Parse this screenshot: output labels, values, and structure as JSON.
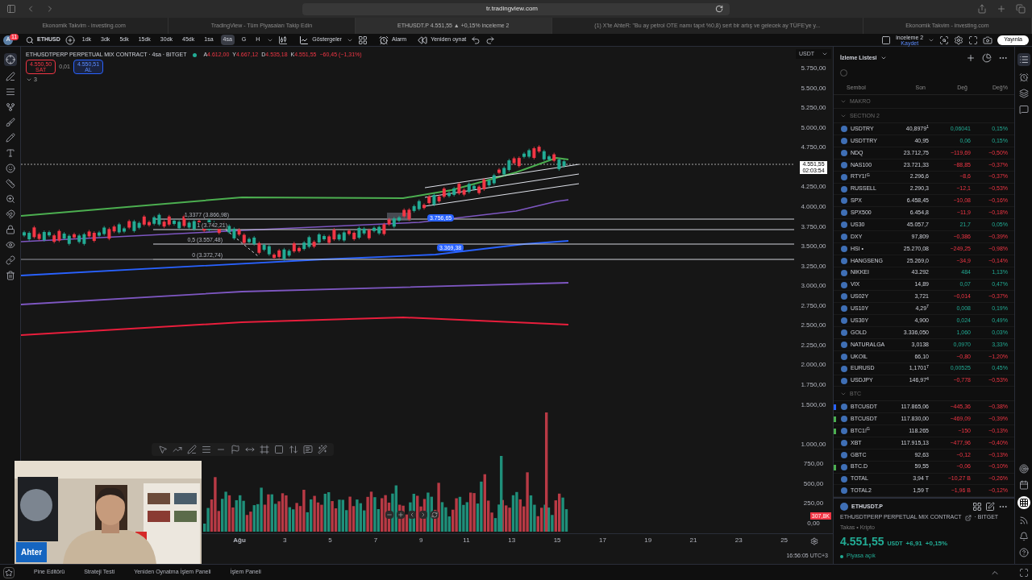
{
  "browser": {
    "address": "tr.tradingview.com",
    "tabs": [
      {
        "title": "Ekonomik Takvim - investing.com",
        "selected": false
      },
      {
        "title": "TradingView - Tüm Piyasaları Takip Edin",
        "selected": false
      },
      {
        "title": "ETHUSDT.P 4.551,55 ▲ +0,15% inceleme 2",
        "selected": true
      },
      {
        "title": "(1) X'te AhteR: \"Bu ay petrol OTE namı tapıt %0,8) sert bir artış ve gelecek ay TÜFE'ye y...",
        "selected": false
      },
      {
        "title": "Ekonomik Takvim - investing.com",
        "selected": false
      }
    ]
  },
  "toolbar": {
    "avatar": "A",
    "notifications": "11",
    "symbol": "ETHUSD",
    "intervals": [
      {
        "label": "1dk",
        "selected": false
      },
      {
        "label": "3dk",
        "selected": false
      },
      {
        "label": "5dk",
        "selected": false
      },
      {
        "label": "15dk",
        "selected": false
      },
      {
        "label": "30dk",
        "selected": false
      },
      {
        "label": "45dk",
        "selected": false
      },
      {
        "label": "1sa",
        "selected": false
      },
      {
        "label": "4sa",
        "selected": true
      },
      {
        "label": "G",
        "selected": false
      },
      {
        "label": "H",
        "selected": false
      }
    ],
    "indicators": "Göstergeler",
    "alert": "Alarm",
    "replay": "Yeniden oynat",
    "layout_name": "inceleme 2",
    "layout_status": "Kaydet",
    "publish": "Yayınla"
  },
  "chart": {
    "title": "ETHUSDTPERP PERPETUAL MIX CONTRACT · 4sa · BITGET",
    "ohlc": [
      {
        "label": "A",
        "value": "4.612,00"
      },
      {
        "label": "Y",
        "value": "4.667,12"
      },
      {
        "label": "D",
        "value": "4.535,18"
      },
      {
        "label": "K",
        "value": "4.551,55"
      }
    ],
    "change": "−60,45 (−1,31%)",
    "sell_price": "4.550,50",
    "sell_label": "SAT",
    "spread": "0,01",
    "buy_price": "4.550,51",
    "buy_label": "AL",
    "indicator_count": "3",
    "currency": "USDT",
    "price_axis": [
      "5.750,00",
      "5.500,00",
      "5.250,00",
      "5.000,00",
      "4.750,00",
      "4.250,00",
      "4.000,00",
      "3.750,00",
      "3.500,00",
      "3.250,00",
      "3.000,00",
      "2.750,00",
      "2.500,00",
      "2.250,00",
      "2.000,00",
      "1.750,00",
      "1.500,00"
    ],
    "last_price": "4.551,55",
    "countdown": "02:03:54",
    "volume_axis": [
      "1.000,00",
      "750,00",
      "500,00",
      "250,00",
      "0,00"
    ],
    "volume_label": "307,8K",
    "fib_levels": [
      "1,3377 (3.866,98)",
      "1 (3.742,21)",
      "0,5 (3.557,48)",
      "0 (3.372,74)"
    ],
    "line_labels": [
      "3.756,65",
      "3.369,38"
    ],
    "time_axis": [
      "Ağu",
      "3",
      "5",
      "7",
      "9",
      "11",
      "13",
      "15",
      "17",
      "19",
      "21",
      "23",
      "25"
    ],
    "clock": "16:56:05 UTC+3"
  },
  "webcam": {
    "kind": "picture",
    "name": "Ahter"
  },
  "watchlist": {
    "title": "İzleme Listesi",
    "columns": [
      "Sembol",
      "Son",
      "Değ",
      "Değ%"
    ],
    "sections": [
      {
        "name": "MAKRO"
      },
      {
        "name": "SECTION 2",
        "rows": [
          {
            "symbol": "USDTRY",
            "last": "40,8979$^{1}$",
            "change": "0,06041",
            "pct": "0,15%",
            "down": false
          },
          {
            "symbol": "USDTTRY",
            "last": "40,95",
            "change": "0,06",
            "pct": "0,15%",
            "down": false
          },
          {
            "symbol": "NDQ",
            "last": "23.712,75",
            "change": "−119,69",
            "pct": "−0,50%",
            "down": true
          },
          {
            "symbol": "NAS100",
            "last": "23.721,33",
            "change": "−88,85",
            "pct": "−0,37%",
            "down": true
          },
          {
            "symbol": "RTY1!$^{G}$",
            "last": "2.296,6",
            "change": "−8,6",
            "pct": "−0,37%",
            "down": true
          },
          {
            "symbol": "RUSSELL",
            "last": "2.290,3",
            "change": "−12,1",
            "pct": "−0,53%",
            "down": true
          },
          {
            "symbol": "SPX",
            "last": "6.458,45",
            "change": "−10,08",
            "pct": "−0,16%",
            "down": true
          },
          {
            "symbol": "SPX500",
            "last": "6.454,8",
            "change": "−11,9",
            "pct": "−0,18%",
            "down": true
          },
          {
            "symbol": "US30",
            "last": "45.057,7",
            "change": "21,7",
            "pct": "0,05%",
            "down": false
          },
          {
            "symbol": "DXY",
            "last": "97,809",
            "change": "−0,386",
            "pct": "−0,39%",
            "down": true
          },
          {
            "symbol": "HSI •",
            "last": "25.270,08",
            "change": "−249,25",
            "pct": "−0,98%",
            "down": true
          },
          {
            "symbol": "HANGSENG",
            "last": "25.269,0",
            "change": "−34,9",
            "pct": "−0,14%",
            "down": true
          },
          {
            "symbol": "NIKKEI",
            "last": "43.292",
            "change": "484",
            "pct": "1,13%",
            "down": false
          },
          {
            "symbol": "VIX",
            "last": "14,89",
            "change": "0,07",
            "pct": "0,47%",
            "down": false
          },
          {
            "symbol": "US02Y",
            "last": "3,721",
            "change": "−0,014",
            "pct": "−0,37%",
            "down": true
          },
          {
            "symbol": "US10Y",
            "last": "4,29$^{7}$",
            "change": "0,008",
            "pct": "0,19%",
            "down": false
          },
          {
            "symbol": "US30Y",
            "last": "4,900",
            "change": "0,024",
            "pct": "0,49%",
            "down": false
          },
          {
            "symbol": "GOLD",
            "last": "3.336,050",
            "change": "1,060",
            "pct": "0,03%",
            "down": false
          },
          {
            "symbol": "NATURALGA",
            "last": "3,0138",
            "change": "0,0970",
            "pct": "3,33%",
            "down": false
          },
          {
            "symbol": "UKOIL",
            "last": "66,10",
            "change": "−0,80",
            "pct": "−1,20%",
            "down": true
          },
          {
            "symbol": "EURUSD",
            "last": "1,1701$^{7}$",
            "change": "0,00525",
            "pct": "0,45%",
            "down": false
          },
          {
            "symbol": "USDJPY",
            "last": "146,97$^{4}$",
            "change": "−0,778",
            "pct": "−0,53%",
            "down": true
          }
        ]
      },
      {
        "name": "BTC",
        "rows": [
          {
            "symbol": "BTCUSDT",
            "last": "117.865,06",
            "change": "−445,36",
            "pct": "−0,38%",
            "down": true,
            "color": "#2962ff"
          },
          {
            "symbol": "BTCUSDT",
            "last": "117.830,00",
            "change": "−469,09",
            "pct": "−0,39%",
            "down": true,
            "color": "#4caf50"
          },
          {
            "symbol": "BTC1!$^{G}$",
            "last": "118.265",
            "change": "−150",
            "pct": "−0,13%",
            "down": true,
            "color": "#4caf50"
          },
          {
            "symbol": "XBT",
            "last": "117.915,13",
            "change": "−477,96",
            "pct": "−0,40%",
            "down": true
          },
          {
            "symbol": "GBTC",
            "last": "92,63",
            "change": "−0,12",
            "pct": "−0,13%",
            "down": true
          },
          {
            "symbol": "BTC.D",
            "last": "59,55",
            "change": "−0,06",
            "pct": "−0,10%",
            "down": true,
            "color": "#4caf50"
          },
          {
            "symbol": "TOTAL",
            "last": "3,94 T",
            "change": "−10,27 B",
            "pct": "−0,26%",
            "down": true
          },
          {
            "symbol": "TOTAL2",
            "last": "1,59 T",
            "change": "−1,96 B",
            "pct": "−0,12%",
            "down": true
          }
        ]
      }
    ]
  },
  "details": {
    "symbol": "ETHUSDT.P",
    "description": "ETHUSDTPERP PERPETUAL MIX CONTRACT",
    "exchange": "· BITGET",
    "category": "Takas • Kripto",
    "price": "4.551,55",
    "currency": "USDT",
    "change": "+6,91",
    "pct": "+0,15%",
    "status": "Piyasa açık"
  },
  "bottom_tabs": [
    "Pine Editörü",
    "Strateji Testi",
    "Yeniden Oynatma İşlem Paneli",
    "İşlem Paneli"
  ]
}
